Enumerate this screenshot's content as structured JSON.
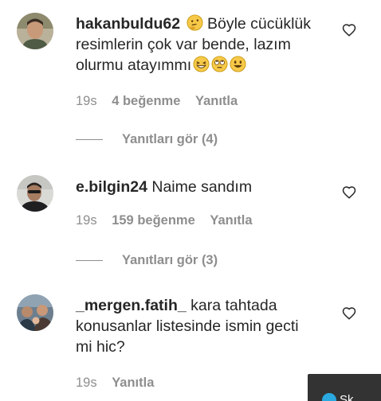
{
  "comments": [
    {
      "username": "hakanbuldu62",
      "text_before": "Böyle cücüklük resimlerin çok var bende, lazım olurmu atayımmı",
      "emojis": [
        "thinking-face-emoji",
        "grinning-squinting-emoji",
        "rolling-eyes-emoji",
        "grinning-face-emoji"
      ],
      "time": "19s",
      "likes": "4 beğenme",
      "reply_label": "Yanıtla",
      "view_replies": "Yanıtları gör (4)"
    },
    {
      "username": "e.bilgin24",
      "text": "Naime sandım",
      "time": "19s",
      "likes": "159 beğenme",
      "reply_label": "Yanıtla",
      "view_replies": "Yanıtları gör (3)"
    },
    {
      "username": "_mergen.fatih_",
      "text": "kara tahtada konusanlar listesinde ismin gecti mi hic?",
      "time": "19s",
      "reply_label": "Yanıtla"
    }
  ],
  "popup": {
    "text": "Sk"
  },
  "colors": {
    "text": "#262626",
    "secondary": "#8e8e8e",
    "popup_bg": "#333333"
  }
}
